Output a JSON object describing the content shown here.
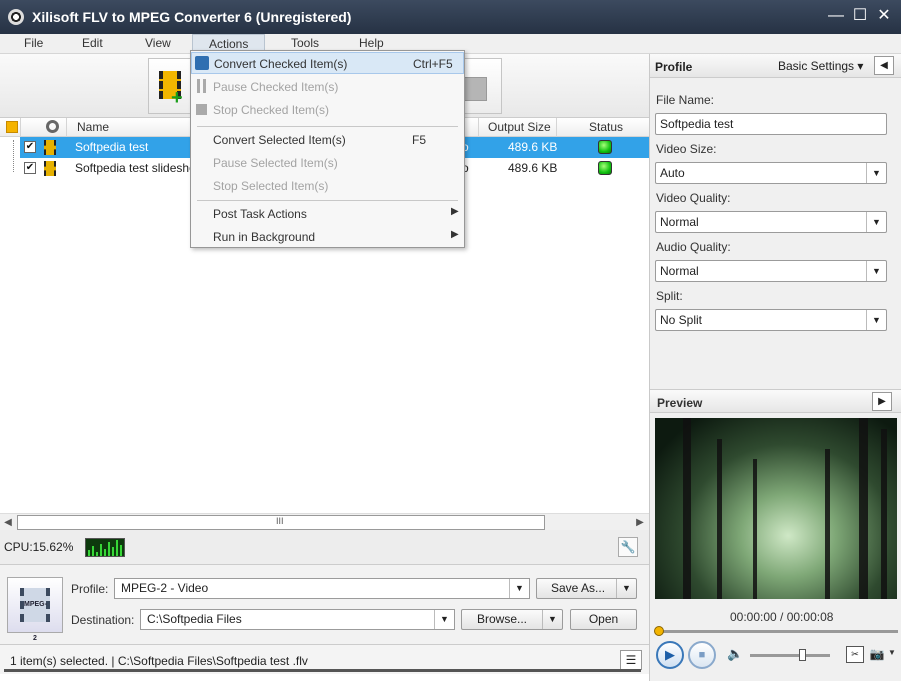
{
  "window": {
    "title": "Xilisoft FLV to MPEG Converter 6 (Unregistered)",
    "minimize_glyph": "—",
    "maximize_glyph": "☐",
    "close_glyph": "✕"
  },
  "menubar": {
    "items": [
      "File",
      "Edit",
      "View",
      "Actions",
      "Tools",
      "Help"
    ]
  },
  "file_list": {
    "columns": {
      "name": "Name",
      "output_size": "Output Size",
      "status": "Status"
    },
    "rows": [
      {
        "name": "Softpedia test",
        "output_size": "489.6 KB",
        "truncated_tail": "o",
        "checked": true,
        "selected": true,
        "status": "ready"
      },
      {
        "name": "Softpedia test slidesho",
        "output_size": "489.6 KB",
        "truncated_tail": "o",
        "checked": true,
        "selected": false,
        "status": "ready"
      }
    ],
    "scroll_grip": "III"
  },
  "actions_menu": {
    "items": [
      {
        "label": "Convert Checked Item(s)",
        "shortcut": "Ctrl+F5",
        "enabled": true,
        "highlighted": true
      },
      {
        "label": "Pause Checked Item(s)",
        "shortcut": "",
        "enabled": false
      },
      {
        "label": "Stop Checked Item(s)",
        "shortcut": "",
        "enabled": false
      },
      {
        "label": "Convert Selected Item(s)",
        "shortcut": "F5",
        "enabled": true
      },
      {
        "label": "Pause Selected Item(s)",
        "shortcut": "",
        "enabled": false
      },
      {
        "label": "Stop Selected Item(s)",
        "shortcut": "",
        "enabled": false
      },
      {
        "label": "Post Task Actions",
        "shortcut": "",
        "enabled": true,
        "submenu": true
      },
      {
        "label": "Run in Background",
        "shortcut": "",
        "enabled": true,
        "submenu": true
      }
    ]
  },
  "cpu": {
    "label": "CPU:15.62%"
  },
  "output": {
    "format_icon_text": "MPEG-2",
    "profile_label": "Profile:",
    "profile_value": "MPEG-2 - Video",
    "save_as": "Save As...",
    "destination_label": "Destination:",
    "destination_value": "C:\\Softpedia Files",
    "browse": "Browse...",
    "open": "Open"
  },
  "statusbar": {
    "text": "1 item(s) selected. | C:\\Softpedia Files\\Softpedia test .flv"
  },
  "profile_panel": {
    "title": "Profile",
    "settings_mode": "Basic Settings",
    "file_name_label": "File Name:",
    "file_name_value": "Softpedia test",
    "video_size_label": "Video Size:",
    "video_size_value": "Auto",
    "video_quality_label": "Video Quality:",
    "video_quality_value": "Normal",
    "audio_quality_label": "Audio Quality:",
    "audio_quality_value": "Normal",
    "split_label": "Split:",
    "split_value": "No Split"
  },
  "preview_panel": {
    "title": "Preview",
    "time": "00:00:00 / 00:00:08",
    "seek_position": 0,
    "volume_level": 0.65
  },
  "colors": {
    "selection": "#32a2e8",
    "titlebar": "#2e3a4e",
    "status_ok": "#12c312",
    "accent_gold": "#f3b400"
  },
  "icons": {
    "app": "disc-icon",
    "add_file": "add-video-icon",
    "convert": "convert-icon",
    "wrench": "wrench-icon",
    "log": "log-icon",
    "play": "play-icon",
    "stop": "stop-icon",
    "volume": "volume-icon",
    "snapshot": "camera-icon"
  }
}
